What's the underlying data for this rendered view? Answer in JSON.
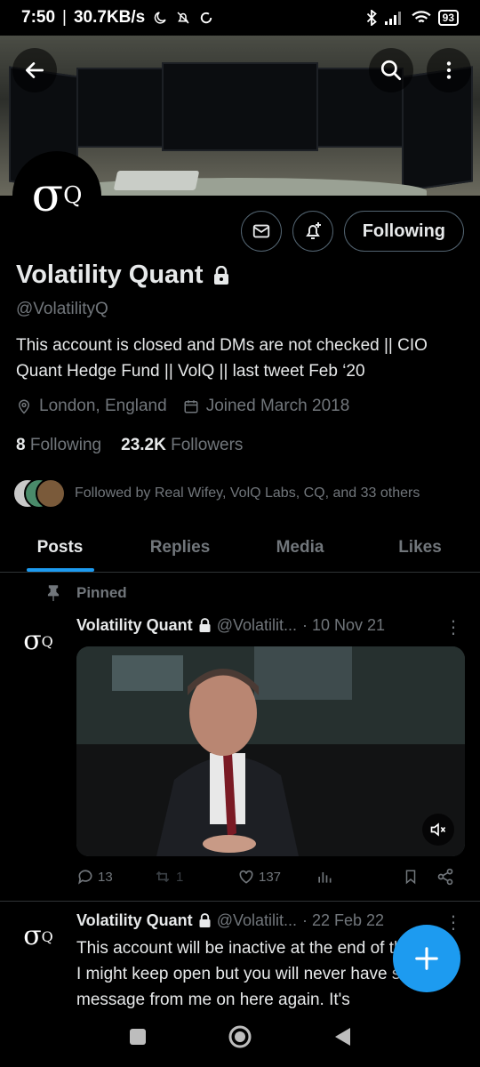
{
  "status_bar": {
    "time": "7:50",
    "net_speed": "30.7KB/s",
    "battery": "93"
  },
  "profile": {
    "name": "Volatility Quant",
    "handle": "@VolatilityQ",
    "bio": "This account is closed and DMs are not checked || CIO Quant Hedge Fund || VolQ || last tweet Feb ‘20",
    "location": "London, England",
    "joined": "Joined March 2018",
    "following_count": "8",
    "following_label": "Following",
    "followers_count": "23.2K",
    "followers_label": "Followers",
    "followed_by": "Followed by Real Wifey, VolQ Labs, CQ, and 33 others",
    "follow_button": "Following",
    "avatar_sigma": "σ",
    "avatar_sub": "Q"
  },
  "tabs": [
    "Posts",
    "Replies",
    "Media",
    "Likes"
  ],
  "pinned_label": "Pinned",
  "posts": [
    {
      "name": "Volatility Quant",
      "handle": "@Volatilit...",
      "date": "· 10 Nov 21",
      "replies": "13",
      "reposts": "1",
      "likes": "137"
    },
    {
      "name": "Volatility Quant",
      "handle": "@Volatilit...",
      "date": "· 22 Feb 22",
      "text": "This account will be inactive at the end of the week. I might keep open but you will never have seen a message from me on here again. It's"
    }
  ],
  "colors": {
    "accent": "#1d9bf0",
    "muted": "#71767b",
    "text": "#e7e9ea",
    "border": "#2f3336"
  }
}
